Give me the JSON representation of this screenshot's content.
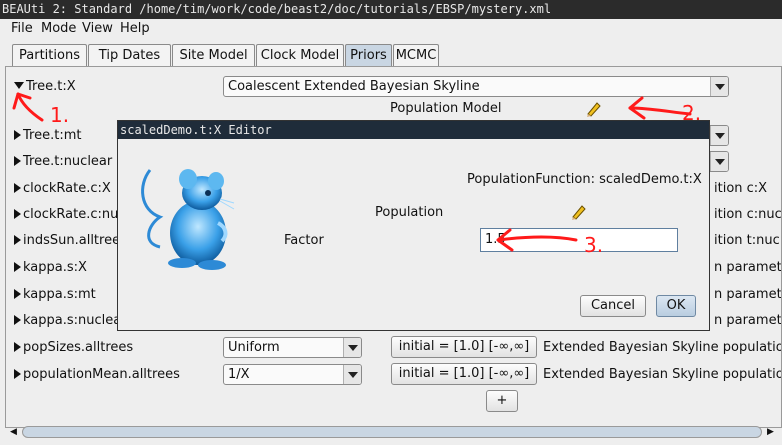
{
  "window": {
    "title": "BEAUti 2: Standard /home/tim/work/code/beast2/doc/tutorials/EBSP/mystery.xml"
  },
  "menu": {
    "items": [
      "File",
      "Mode",
      "View",
      "Help"
    ]
  },
  "tabs": [
    "Partitions",
    "Tip Dates",
    "Site Model",
    "Clock Model",
    "Priors",
    "MCMC"
  ],
  "active_tab": "Priors",
  "priors": {
    "rows": [
      {
        "label": "Tree.t:X",
        "expanded": true,
        "prior": "Coalescent Extended Bayesian Skyline"
      },
      {
        "label": "Tree.t:mt",
        "expanded": false
      },
      {
        "label": "Tree.t:nuclear",
        "expanded": false
      },
      {
        "label": "clockRate.c:X",
        "expanded": false,
        "desc": "ition c:X"
      },
      {
        "label": "clockRate.c:nuc",
        "expanded": false,
        "desc": "ition c:nuc"
      },
      {
        "label": "indsSun.alltree",
        "expanded": false,
        "desc": "ition t:nuc"
      },
      {
        "label": "kappa.s:X",
        "expanded": false,
        "desc": "n paramet"
      },
      {
        "label": "kappa.s:mt",
        "expanded": false,
        "desc": "n paramet"
      },
      {
        "label": "kappa.s:nuclea",
        "expanded": false,
        "desc": "n paramet"
      },
      {
        "label": "popSizes.alltrees",
        "expanded": false,
        "prior": "Uniform",
        "initial": "initial = [1.0] [-∞,∞]",
        "desc": "Extended Bayesian Skyline population"
      },
      {
        "label": "populationMean.alltrees",
        "expanded": false,
        "prior": "1/X",
        "initial": "initial = [1.0] [-∞,∞]",
        "desc": "Extended Bayesian Skyline population"
      }
    ],
    "population_model_label": "Population Model",
    "add_button": "+"
  },
  "dialog": {
    "title": "scaledDemo.t:X Editor",
    "population_function": "PopulationFunction: scaledDemo.t:X",
    "population_label": "Population",
    "factor_label": "Factor",
    "factor_value": "1.5",
    "cancel": "Cancel",
    "ok": "OK"
  },
  "annotations": {
    "a1": "1.",
    "a2": "2.",
    "a3": "3."
  },
  "colors": {
    "titlebar": "#2b2b2b",
    "active_tab": "#c9d6e3",
    "annotation": "#ff1a1a",
    "mascot": "#3aa0e8"
  }
}
